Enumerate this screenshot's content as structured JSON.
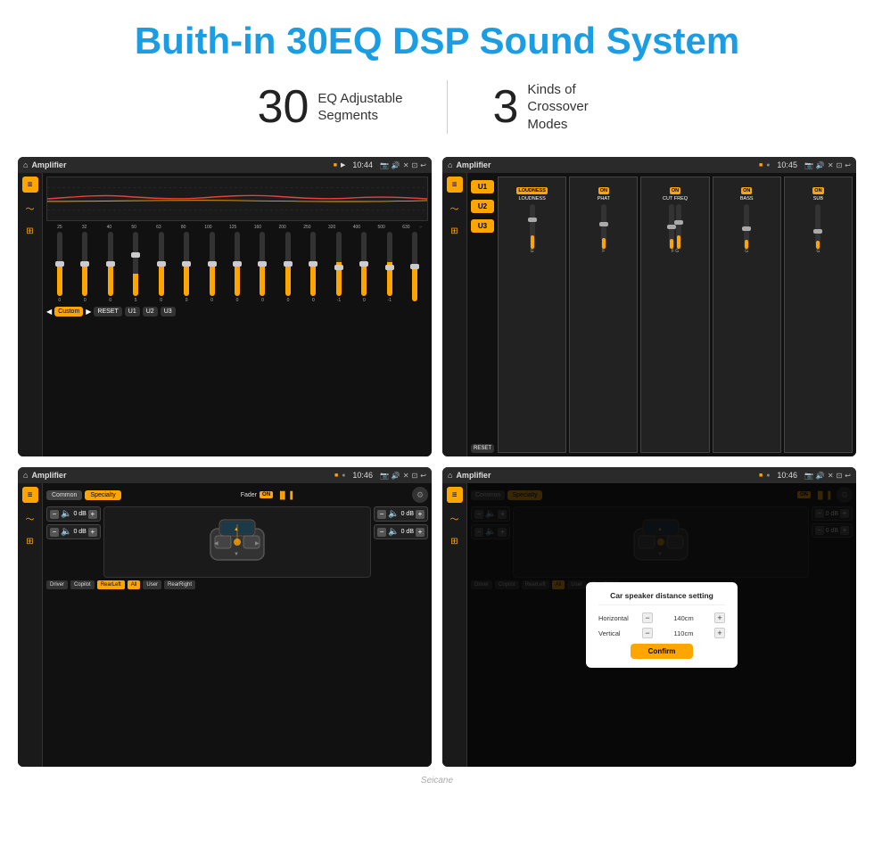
{
  "page": {
    "title": "Buith-in 30EQ DSP Sound System",
    "stats": [
      {
        "number": "30",
        "label": "EQ Adjustable\nSegments"
      },
      {
        "number": "3",
        "label": "Kinds of\nCrossover Modes"
      }
    ],
    "watermark": "Seicane"
  },
  "screen1": {
    "app": "Amplifier",
    "time": "10:44",
    "eq_freqs": [
      "25",
      "32",
      "40",
      "50",
      "63",
      "80",
      "100",
      "125",
      "160",
      "200",
      "250",
      "320",
      "400",
      "500",
      "630"
    ],
    "eq_values": [
      "0",
      "0",
      "0",
      "5",
      "0",
      "0",
      "0",
      "0",
      "0",
      "0",
      "0",
      "-1",
      "0",
      "-1",
      ""
    ],
    "buttons": [
      "Custom",
      "RESET",
      "U1",
      "U2",
      "U3"
    ]
  },
  "screen2": {
    "app": "Amplifier",
    "time": "10:45",
    "u_buttons": [
      "U1",
      "U2",
      "U3"
    ],
    "filters": [
      {
        "label": "LOUDNESS",
        "on": true
      },
      {
        "label": "PHAT",
        "on": true
      },
      {
        "label": "CUT FREQ",
        "on": true
      },
      {
        "label": "BASS",
        "on": true
      },
      {
        "label": "SUB",
        "on": true
      }
    ],
    "reset_btn": "RESET"
  },
  "screen3": {
    "app": "Amplifier",
    "time": "10:46",
    "tabs": [
      "Common",
      "Specialty"
    ],
    "active_tab": "Specialty",
    "fader_label": "Fader",
    "on_badge": "ON",
    "positions": {
      "top_left": "0 dB",
      "top_right": "0 dB",
      "bottom_left": "0 dB",
      "bottom_right": "0 dB"
    },
    "buttons": [
      "Driver",
      "Copilot",
      "RearLeft",
      "All",
      "User",
      "RearRight"
    ]
  },
  "screen4": {
    "app": "Amplifier",
    "time": "10:46",
    "tabs": [
      "Common",
      "Specialty"
    ],
    "on_badge": "ON",
    "dialog": {
      "title": "Car speaker distance setting",
      "rows": [
        {
          "label": "Horizontal",
          "value": "140cm"
        },
        {
          "label": "Vertical",
          "value": "110cm"
        }
      ],
      "confirm_btn": "Confirm"
    },
    "positions": {
      "top_right": "0 dB",
      "bottom_right": "0 dB"
    },
    "buttons": [
      "Driver",
      "Copilot",
      "RearLeft",
      "All",
      "User",
      "RearRight"
    ]
  }
}
